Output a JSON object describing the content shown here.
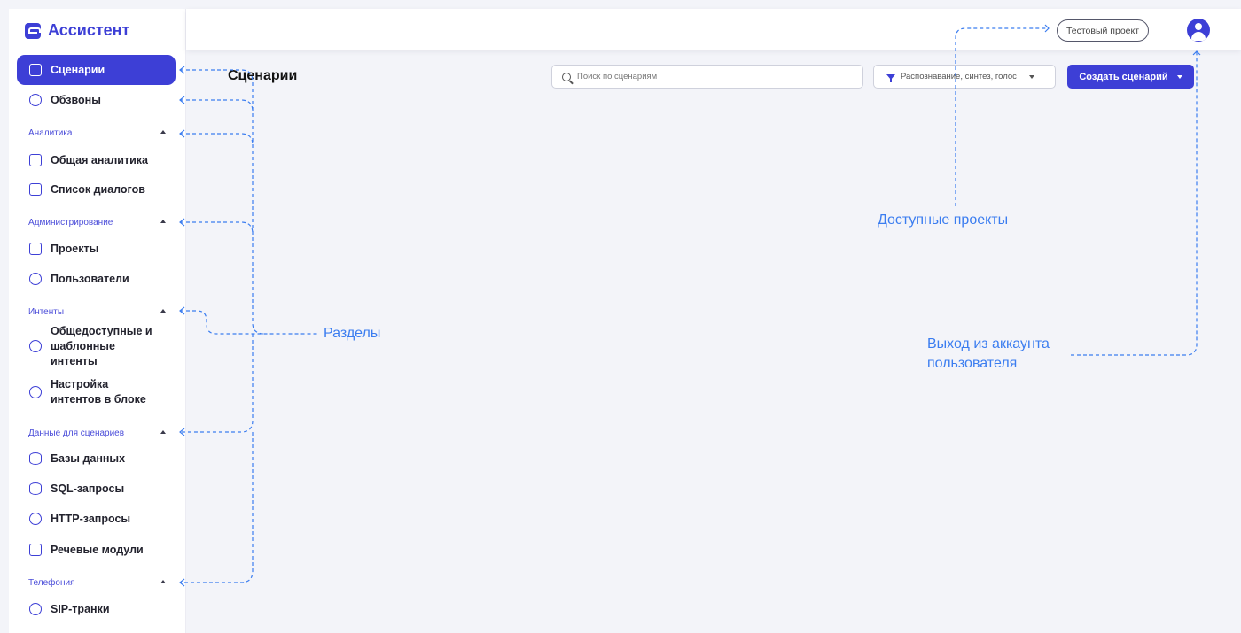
{
  "app": {
    "title": "Ассистент"
  },
  "header": {
    "project_button": "Тестовый проект",
    "avatar_icon": "user-circle-icon"
  },
  "page": {
    "title": "Сценарии",
    "search_placeholder": "Поиск по сценариям",
    "filter_label": "Распознавание, синтез, голос",
    "create_button": "Создать сценарий"
  },
  "sidebar": {
    "items": [
      {
        "label": "Сценарии",
        "icon": "scenarios-icon",
        "active": true
      },
      {
        "label": "Обзвоны",
        "icon": "phone-calls-icon"
      },
      {
        "label": "Общая аналитика",
        "icon": "analytics-icon"
      },
      {
        "label": "Список диалогов",
        "icon": "dialogs-icon"
      },
      {
        "label": "Проекты",
        "icon": "projects-icon"
      },
      {
        "label": "Пользователи",
        "icon": "users-icon"
      },
      {
        "label": "Общедоступные и шаблонные интенты",
        "icon": "public-intents-icon"
      },
      {
        "label": "Настройка интентов в блоке",
        "icon": "intent-settings-icon"
      },
      {
        "label": "Базы данных",
        "icon": "database-icon"
      },
      {
        "label": "SQL-запросы",
        "icon": "sql-icon"
      },
      {
        "label": "HTTP-запросы",
        "icon": "http-icon"
      },
      {
        "label": "Речевые модули",
        "icon": "speech-modules-icon"
      },
      {
        "label": "SIP-транки",
        "icon": "sip-trunks-icon"
      }
    ],
    "sections": [
      {
        "label": "Аналитика"
      },
      {
        "label": "Администрирование"
      },
      {
        "label": "Интенты"
      },
      {
        "label": "Данные для сценариев"
      },
      {
        "label": "Телефония"
      }
    ]
  },
  "annotations": {
    "sections": "Разделы",
    "projects": "Доступные проекты",
    "logout": "Выход из аккаунта пользователя",
    "logout_line1": "Выход из аккаунта",
    "logout_line2": "пользователя",
    "color": "#3b7df0"
  },
  "colors": {
    "accent": "#3d3fd6",
    "background": "#f3f4f9",
    "annotation": "#3b7df0"
  }
}
